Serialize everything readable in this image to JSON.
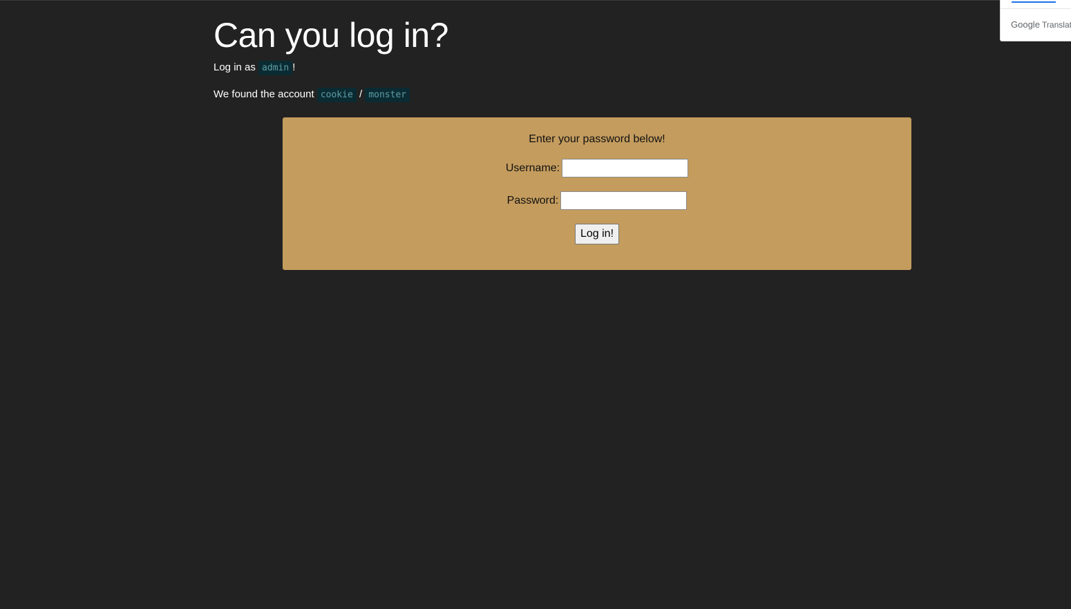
{
  "page": {
    "heading": "Can you log in?",
    "line1": {
      "prefix": "Log in as ",
      "user": "admin",
      "suffix": "!"
    },
    "line2": {
      "prefix": "We found the account ",
      "username": "cookie",
      "separator": " / ",
      "password": "monster"
    }
  },
  "form": {
    "title": "Enter your password below!",
    "username_label": "Username:",
    "username_value": "",
    "password_label": "Password:",
    "password_value": "",
    "submit_label": "Log in!"
  },
  "translate_widget": {
    "brand": "Google",
    "product": "Translate"
  },
  "colors": {
    "background": "#222222",
    "panel": "#c49c5e",
    "code_bg": "#0b2b33"
  }
}
